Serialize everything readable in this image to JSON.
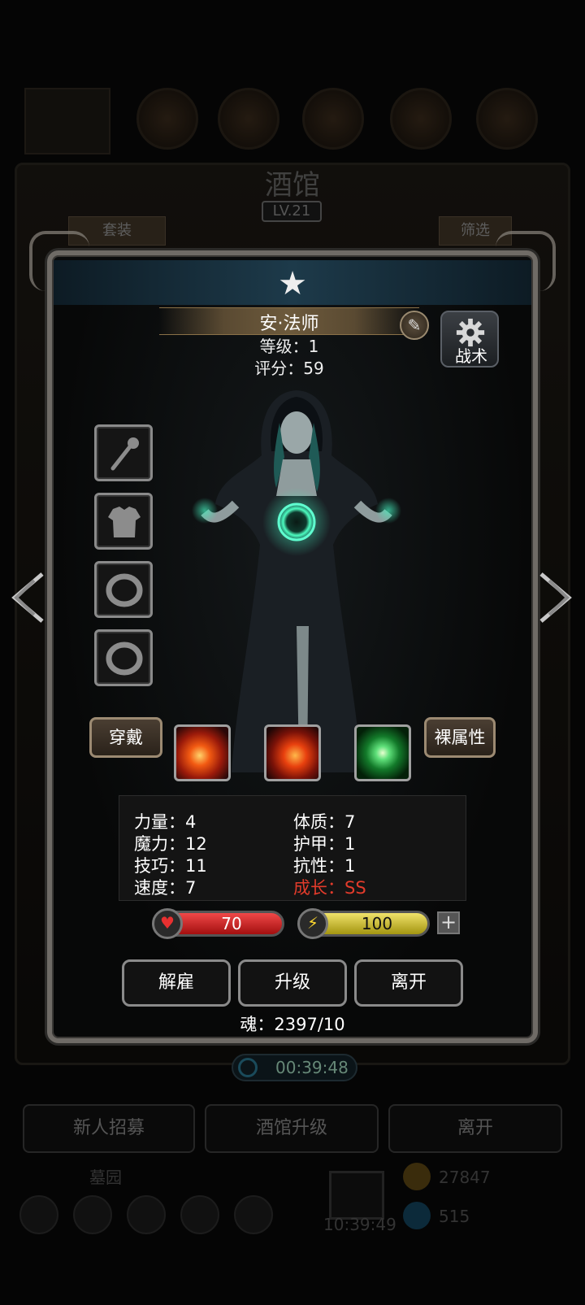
{
  "background": {
    "title": "酒馆",
    "level": "LV.21",
    "tab_left": "套装",
    "tab_right": "筛选",
    "timer": "00:39:48",
    "buttons": [
      "新人招募",
      "酒馆升级",
      "离开"
    ],
    "graveyard": "墓园",
    "clock": "10:39:49",
    "gold": "27847",
    "gems": "515"
  },
  "hero": {
    "name": "安·法师",
    "level_line": "等级：1",
    "score_line": "评分：59",
    "tactics_label": "战术"
  },
  "equipment_slots": [
    {
      "icon": "staff-icon"
    },
    {
      "icon": "armor-icon"
    },
    {
      "icon": "ring-icon"
    },
    {
      "icon": "ring-icon"
    }
  ],
  "buttons": {
    "wear": "穿戴",
    "base_attributes": "裸属性",
    "dismiss": "解雇",
    "upgrade": "升级",
    "leave": "离开"
  },
  "skills": [
    {
      "icon": "fire-skill-icon"
    },
    {
      "icon": "fire-skill-icon"
    },
    {
      "icon": "nature-skill-icon"
    }
  ],
  "stats": {
    "strength": "力量：4",
    "magic": "魔力：12",
    "skill": "技巧：11",
    "speed": "速度：7",
    "constitution": "体质：7",
    "armor": "护甲：1",
    "resistance": "抗性：1",
    "growth": "成长：SS"
  },
  "bars": {
    "hp": "70",
    "energy": "100"
  },
  "soul": "魂：2397/10",
  "colors": {
    "hp": "#c51f1f",
    "energy": "#d8c82c",
    "growth": "#e23b2b"
  }
}
